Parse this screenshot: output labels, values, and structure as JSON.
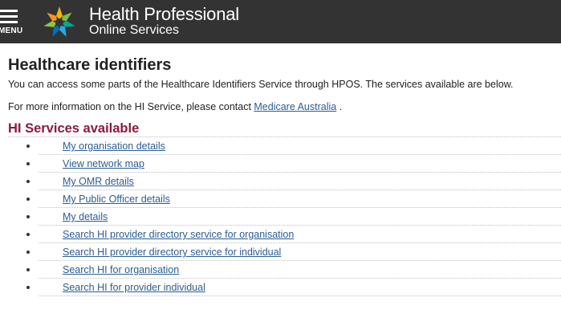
{
  "header": {
    "menu_label": "MENU",
    "brand_line1": "Health Professional",
    "brand_line2": "Online Services"
  },
  "colors": {
    "header_bg": "#333333",
    "link": "#2a5d95",
    "section_title": "#8b1a3a"
  },
  "main": {
    "title": "Healthcare identifiers",
    "intro": "You can access some parts of the Healthcare Identifiers Service through HPOS. The services available are below.",
    "contact_prefix": "For more information on the HI Service, please contact ",
    "contact_link": "Medicare Australia",
    "contact_suffix": " .",
    "services_title": "HI Services available",
    "services": [
      {
        "label": "My organisation details"
      },
      {
        "label": "View network map"
      },
      {
        "label": "My OMR details"
      },
      {
        "label": "My Public Officer details"
      },
      {
        "label": "My details"
      },
      {
        "label": "Search HI provider directory service for organisation"
      },
      {
        "label": "Search HI provider directory service for individual"
      },
      {
        "label": "Search HI for organisation"
      },
      {
        "label": "Search HI for provider individual"
      }
    ]
  }
}
